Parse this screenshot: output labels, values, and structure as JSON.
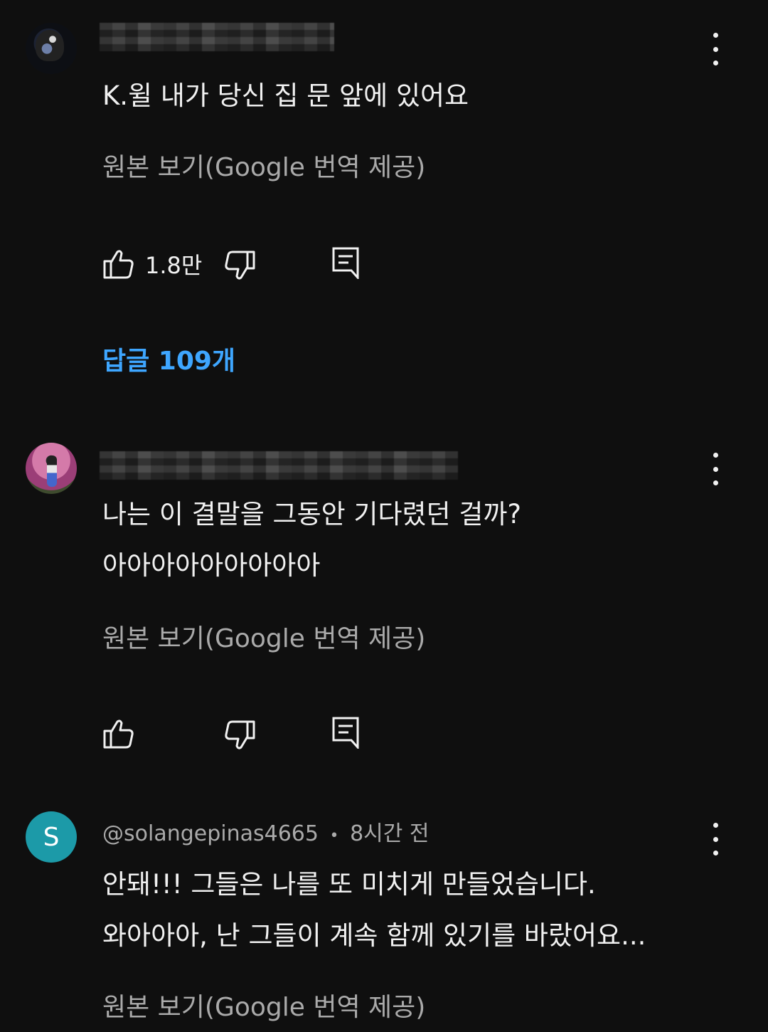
{
  "comments": [
    {
      "body_lines": [
        "K.윌 내가 당신 집 문 앞에 있어요"
      ],
      "translate_label": "원본 보기(Google 번역 제공)",
      "like_count": "1.8만",
      "replies_label": "답글 109개"
    },
    {
      "body_lines": [
        "나는 이 결말을 그동안 기다렸던 걸까?",
        "아아아아아아아아아"
      ],
      "translate_label": "원본 보기(Google 번역 제공)",
      "like_count": ""
    },
    {
      "avatar_letter": "S",
      "author": "@solangepinas4665",
      "separator": "•",
      "time": "8시간 전",
      "body_lines": [
        "안돼!!! 그들은 나를 또 미치게 만들었습니다.",
        "와아아아, 난 그들이 계속 함께 있기를 바랐어요..."
      ],
      "translate_label": "원본 보기(Google 번역 제공)"
    }
  ],
  "icons": {
    "like": "thumbs-up-icon",
    "dislike": "thumbs-down-icon",
    "reply": "comment-reply-icon",
    "more": "more-vert-icon"
  },
  "colors": {
    "background": "#0f0f0f",
    "text": "#f1f1f1",
    "secondary": "#aaaaaa",
    "link": "#3ea6ff",
    "avatar_s": "#1c9aa8"
  }
}
